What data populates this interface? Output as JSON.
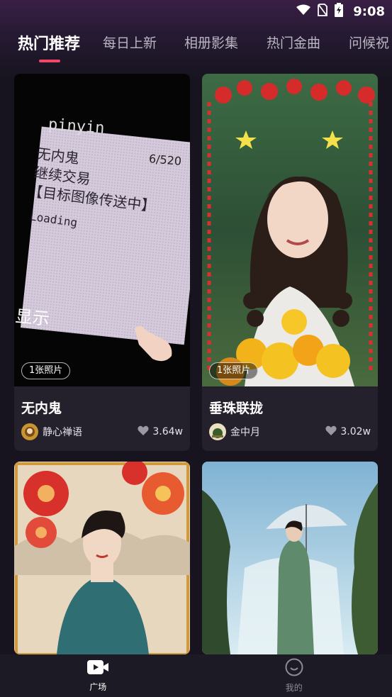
{
  "status_bar": {
    "time": "9:08"
  },
  "tabs": [
    {
      "label": "热门推荐",
      "active": true
    },
    {
      "label": "每日上新"
    },
    {
      "label": "相册影集"
    },
    {
      "label": "热门金曲"
    },
    {
      "label": "问候祝"
    }
  ],
  "cards": [
    {
      "title": "无内鬼",
      "badge": "1张照片",
      "author": "静心禅语",
      "likes": "3.64w",
      "image": {
        "kind": "phone-screen-photo",
        "screen_lines": [
          "pinyin",
          "6/520",
          "无内鬼",
          "继续交易",
          "【目标图像传送中】",
          "Loading",
          "显示"
        ]
      }
    },
    {
      "title": "垂珠联拢",
      "badge": "1张照片",
      "author": "金中月",
      "likes": "3.02w",
      "image": {
        "kind": "portrait-girl-braids-flowers"
      }
    },
    {
      "image": {
        "kind": "qipao-woman-red-flowers"
      }
    },
    {
      "image": {
        "kind": "qipao-woman-umbrella-waterfall"
      }
    }
  ],
  "bottom_nav": [
    {
      "label": "广场",
      "icon": "video-icon",
      "active": true
    },
    {
      "label": "我的",
      "icon": "smile-icon",
      "active": false
    }
  ],
  "colors": {
    "accent": "#f0476b",
    "background": "#17141f",
    "card": "#24212d"
  }
}
